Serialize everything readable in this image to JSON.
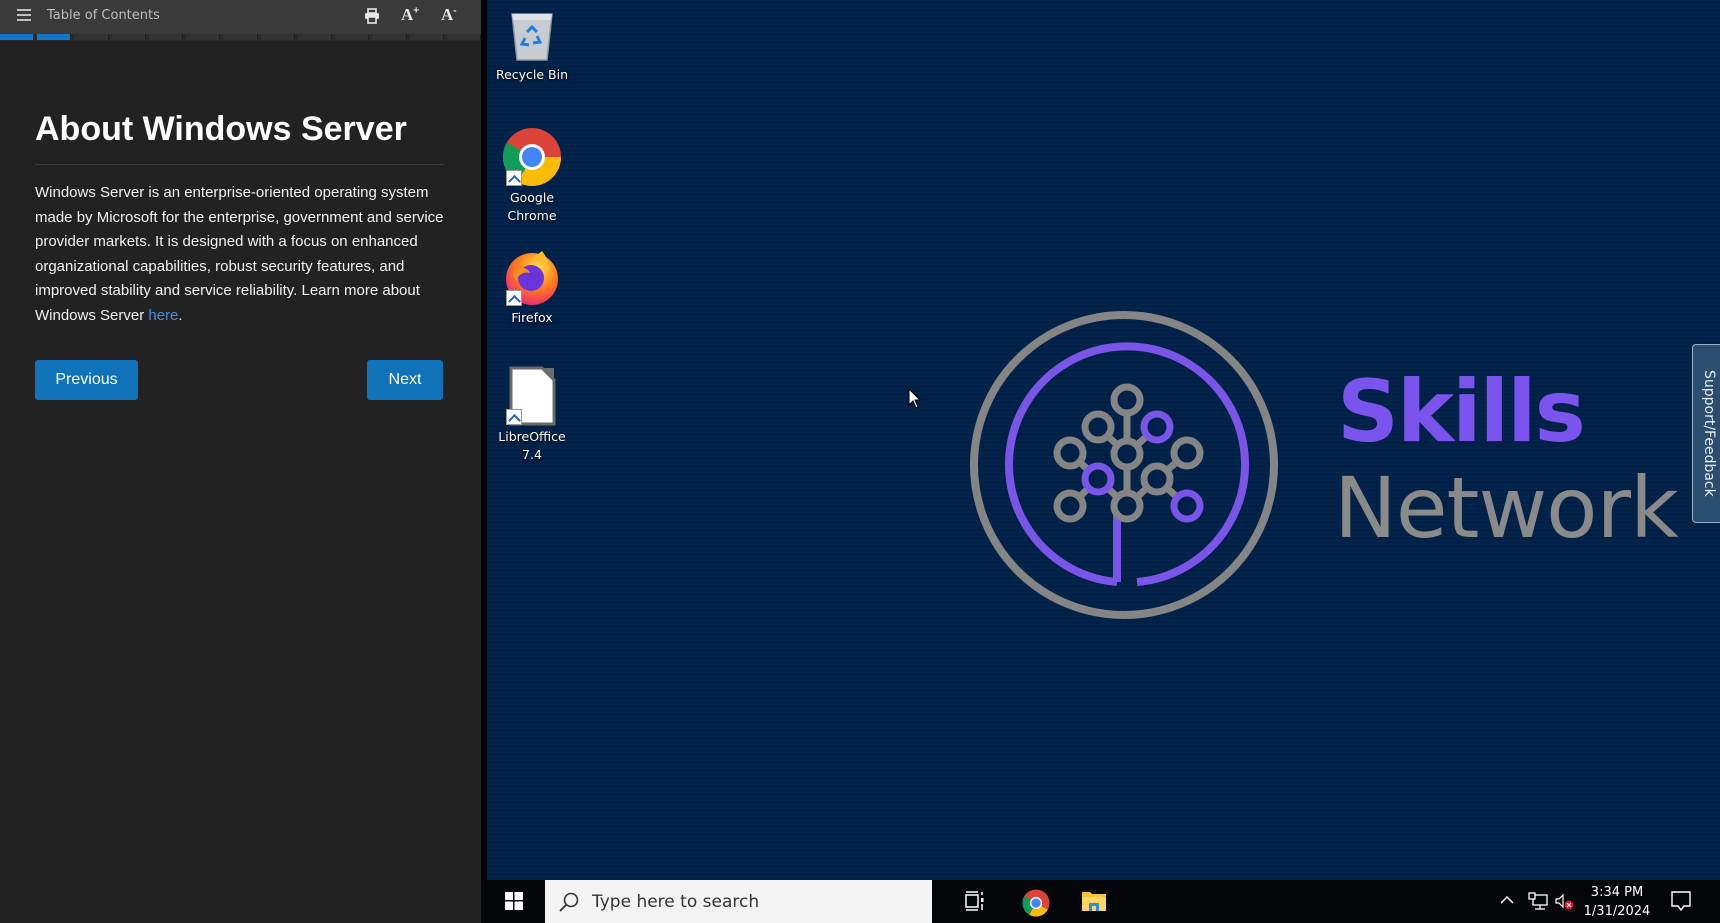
{
  "lab_panel": {
    "toolbar": {
      "menu_icon": "hamburger-menu-icon",
      "toc_label": "Table of Contents",
      "print_icon": "printer-icon",
      "font_increase_label": "A",
      "font_increase_sup": "+",
      "font_decrease_label": "A",
      "font_decrease_sup": "-"
    },
    "progress": {
      "total_steps": 13,
      "completed_steps": 2
    },
    "heading": "About Windows Server",
    "body_text": "Windows Server is an enterprise-oriented operating system made by Microsoft for the enterprise, government and service provider markets. It is designed with a focus on enhanced organizational capabilities, robust security features, and improved stability and service reliability.",
    "learn_more_prefix": "Learn more about Windows Server ",
    "learn_more_link": "here",
    "learn_more_suffix": ".",
    "previous_label": "Previous",
    "next_label": "Next"
  },
  "desktop": {
    "icons": [
      {
        "label": "Recycle Bin",
        "icon": "recycle-bin-icon"
      },
      {
        "label_line1": "Google",
        "label_line2": "Chrome",
        "icon": "chrome-icon"
      },
      {
        "label": "Firefox",
        "icon": "firefox-icon"
      },
      {
        "label_line1": "LibreOffice",
        "label_line2": "7.4",
        "icon": "libreoffice-icon"
      }
    ],
    "brand": {
      "word1": "Skills",
      "word2": "Network"
    },
    "support_tab": "Support/Feedback",
    "colors": {
      "background": "#022148",
      "brand_purple": "#7a54ec",
      "brand_gray": "#8a8a8a"
    }
  },
  "taskbar": {
    "search_placeholder": "Type here to search",
    "pinned": [
      "task-view",
      "google-chrome",
      "file-explorer"
    ],
    "clock_time": "3:34 PM",
    "clock_date": "1/31/2024",
    "volume_state": "muted"
  }
}
